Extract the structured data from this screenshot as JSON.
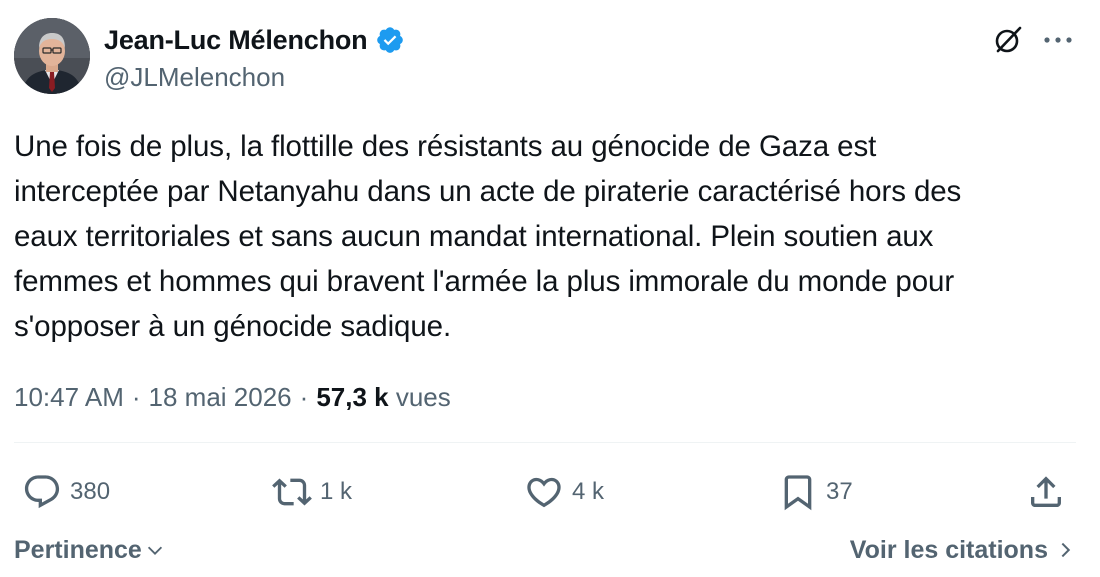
{
  "author": {
    "display_name": "Jean-Luc Mélenchon",
    "handle": "@JLMelenchon",
    "verified": true,
    "verified_color": "#1d9bf0"
  },
  "icons": {
    "grok": "grok-icon",
    "more": "more-horizontal-icon",
    "reply": "reply-icon",
    "repost": "repost-icon",
    "like": "heart-icon",
    "bookmark": "bookmark-icon",
    "share": "share-icon",
    "chevron_down": "chevron-down-icon",
    "chevron_right": "chevron-right-icon"
  },
  "tweet": {
    "text": "Une fois de plus, la flottille des résistants au génocide de Gaza est\ninterceptée par Netanyahu dans un acte de piraterie caractérisé hors des\neaux territoriales et sans aucun mandat international. Plein soutien aux\nfemmes et hommes qui bravent l'armée la plus immorale du monde pour\ns'opposer à un génocide sadique.",
    "time": "10:47 AM",
    "separator1": "·",
    "date": "18 mai 2026",
    "separator2": "·",
    "views_count": "57,3 k",
    "views_label": "vues"
  },
  "actions": {
    "replies": "380",
    "reposts": "1 k",
    "likes": "4 k",
    "bookmarks": "37"
  },
  "footer": {
    "sort_label": "Pertinence",
    "quotes_label": "Voir les citations"
  },
  "colors": {
    "text_primary": "#0f1419",
    "text_secondary": "#536471",
    "divider": "#eff3f4"
  }
}
